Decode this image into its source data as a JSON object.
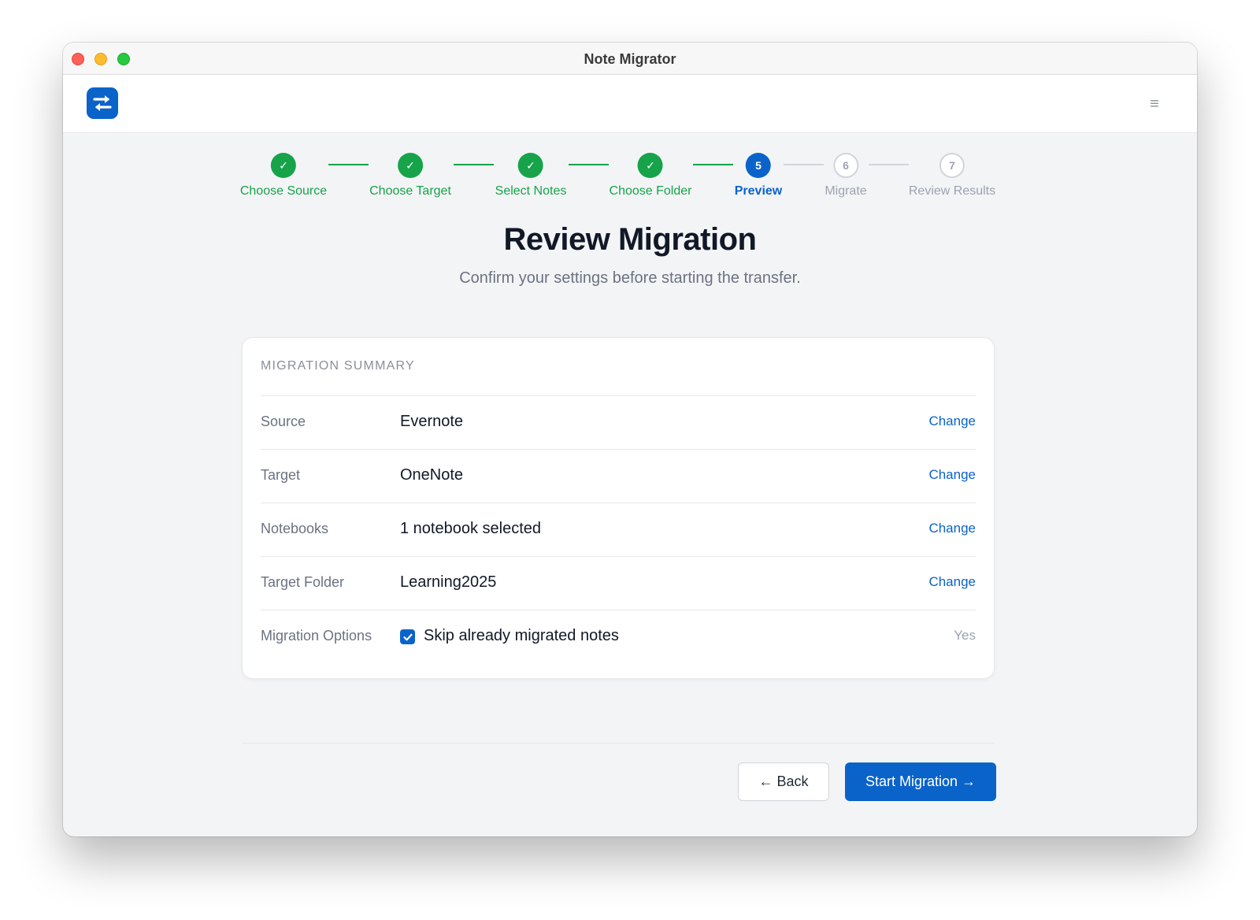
{
  "window": {
    "title": "Note Migrator"
  },
  "appbar": {
    "logo_icon": "swap-arrows-icon",
    "menu_icon": "hamburger-menu-icon",
    "menu_glyph": "≡"
  },
  "stepper": {
    "steps": [
      {
        "number": "1",
        "label": "Choose Source",
        "state": "done",
        "glyph": "✓"
      },
      {
        "number": "2",
        "label": "Choose Target",
        "state": "done",
        "glyph": "✓"
      },
      {
        "number": "3",
        "label": "Select Notes",
        "state": "done",
        "glyph": "✓"
      },
      {
        "number": "4",
        "label": "Choose Folder",
        "state": "done",
        "glyph": "✓"
      },
      {
        "number": "5",
        "label": "Preview",
        "state": "active",
        "glyph": "5"
      },
      {
        "number": "6",
        "label": "Migrate",
        "state": "todo",
        "glyph": "6"
      },
      {
        "number": "7",
        "label": "Review Results",
        "state": "todo",
        "glyph": "7"
      }
    ]
  },
  "page": {
    "title": "Review Migration",
    "subtitle": "Confirm your settings before starting the transfer."
  },
  "summary": {
    "heading": "MIGRATION SUMMARY",
    "rows": [
      {
        "label": "Source",
        "value": "Evernote",
        "action": "Change"
      },
      {
        "label": "Target",
        "value": "OneNote",
        "action": "Change"
      },
      {
        "label": "Notebooks",
        "value": "1 notebook selected",
        "action": "Change"
      },
      {
        "label": "Target Folder",
        "value": "Learning2025",
        "action": "Change"
      }
    ],
    "options": {
      "label": "Migration Options",
      "checkbox_label": "Skip already migrated notes",
      "checked": true,
      "status": "Yes"
    }
  },
  "footer": {
    "back_label": "← Back",
    "start_label": "Start Migration →"
  },
  "colors": {
    "accent": "#0a63c9",
    "success": "#16a34a",
    "muted": "#9ca3af"
  }
}
